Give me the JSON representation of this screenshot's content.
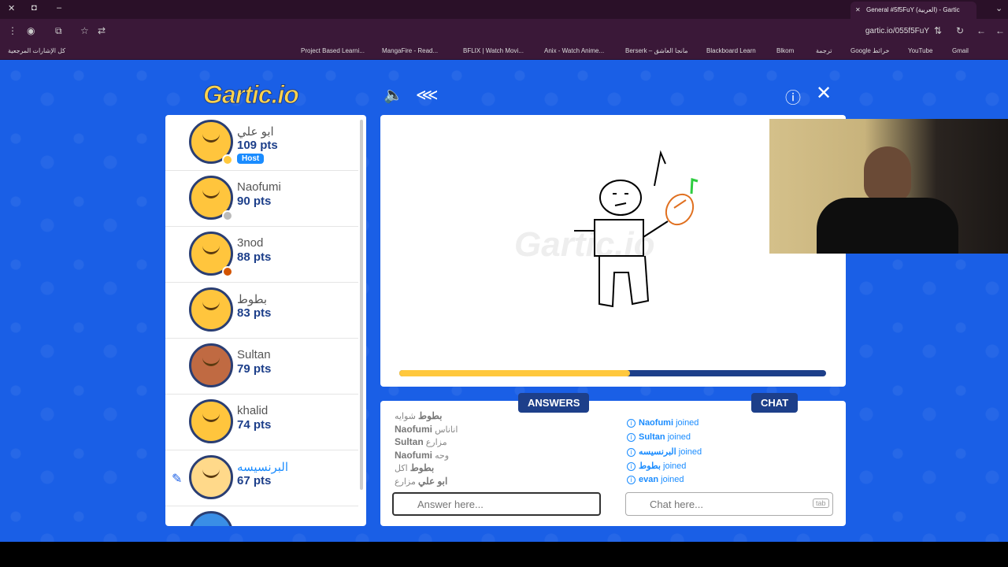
{
  "browser": {
    "tab_title": "General #5f5FuY (العربية) - Gartic",
    "url": "gartic.io/055f5FuY",
    "bookmarks": [
      "كل الإشارات المرجعية",
      "Project Based Learni...",
      "MangaFire - Read...",
      "BFLIX | Watch Movi...",
      "Anix - Watch Anime...",
      "Berserk – مانجا العاشق",
      "Blackboard Learn",
      "Blkom",
      "ترجمة",
      "Google خرائط",
      "YouTube",
      "Gmail"
    ]
  },
  "game": {
    "logo": "Gartic.io",
    "watermark": "Gartic.io",
    "timer_fraction": 0.54
  },
  "players": [
    {
      "name": "ابو علي",
      "pts": "109 pts",
      "host": "Host",
      "dot": "#ffc83d",
      "avatar": "yellow"
    },
    {
      "name": "Naofumi",
      "pts": "90 pts",
      "dot": "#bbbbbb",
      "avatar": "yellow"
    },
    {
      "name": "3nod",
      "pts": "88 pts",
      "dot": "#d35400",
      "avatar": "yellow"
    },
    {
      "name": "بطوط",
      "pts": "83 pts",
      "avatar": "yellow"
    },
    {
      "name": "Sultan",
      "pts": "79 pts",
      "avatar": "brown"
    },
    {
      "name": "khalid",
      "pts": "74 pts",
      "avatar": "yellow"
    },
    {
      "name": "البرنسيسه",
      "pts": "67 pts",
      "avatar": "blonde",
      "drawing": true
    }
  ],
  "answers": {
    "tag": "ANSWERS",
    "items": [
      {
        "user": "بطوط",
        "text": "شوايه"
      },
      {
        "user": "Naofumi",
        "text": "اناناس"
      },
      {
        "user": "Sultan",
        "text": "مزارع"
      },
      {
        "user": "Naofumi",
        "text": "وحه"
      },
      {
        "user": "بطوط",
        "text": "اكل"
      },
      {
        "user": "ابو علي",
        "text": "مزارع"
      }
    ],
    "placeholder": "Answer here..."
  },
  "chat": {
    "tag": "CHAT",
    "items": [
      {
        "user": "Naofumi",
        "text": "joined"
      },
      {
        "user": "Sultan",
        "text": "joined"
      },
      {
        "user": "البرنسيسه",
        "text": "joined"
      },
      {
        "user": "بطوط",
        "text": "joined"
      },
      {
        "user": "evan",
        "text": "joined"
      }
    ],
    "placeholder": "Chat here...",
    "tab_hint": "tab"
  }
}
